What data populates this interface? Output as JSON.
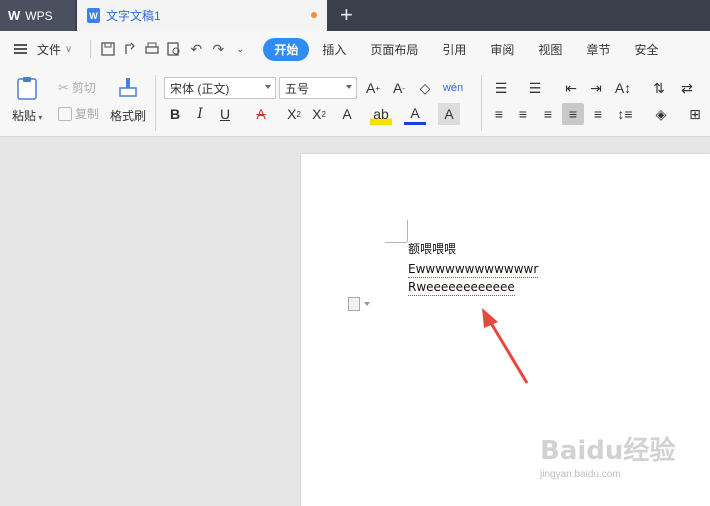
{
  "titlebar": {
    "app_label": "WPS",
    "doc_tab_label": "文字文稿1",
    "new_tab": "+"
  },
  "menu": {
    "file_label": "文件",
    "tabs": [
      "开始",
      "插入",
      "页面布局",
      "引用",
      "审阅",
      "视图",
      "章节",
      "安全"
    ],
    "active_tab": "开始"
  },
  "ribbon": {
    "paste": "粘贴",
    "cut": "剪切",
    "copy": "复制",
    "format_painter": "格式刷",
    "font_name": "宋体 (正文)",
    "font_size": "五号"
  },
  "document": {
    "lines": [
      "额喂喂喂",
      "Ewwwwwwwwwwwwr",
      "Rweeeeeeeeeeee"
    ]
  },
  "watermark": {
    "brand": "Baidu经验",
    "url": "jingyan.baidu.com"
  },
  "colors": {
    "accent": "#2f8cf2",
    "annotation_arrow": "#e8473f",
    "spell_underline": "#e03030"
  }
}
